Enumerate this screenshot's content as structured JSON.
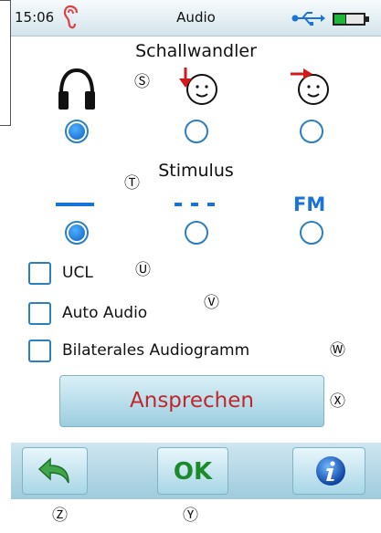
{
  "status": {
    "time": "15:06",
    "title": "Audio",
    "ear_icon": "ear-icon",
    "usb_icon": "usb-icon",
    "battery_icon": "battery-icon"
  },
  "transducer": {
    "title": "Schallwandler",
    "marker": "Ⓢ",
    "options": [
      {
        "icon": "headphones-icon",
        "selected": true
      },
      {
        "icon": "bone-conduction-face-icon",
        "selected": false
      },
      {
        "icon": "free-field-face-icon",
        "selected": false
      }
    ]
  },
  "stimulus": {
    "title": "Stimulus",
    "marker": "Ⓣ",
    "fm_label": "FM",
    "options": [
      {
        "icon": "solid-line-icon",
        "selected": true
      },
      {
        "icon": "dashed-line-icon",
        "selected": false
      },
      {
        "icon": "fm-icon",
        "selected": false
      }
    ]
  },
  "checkboxes": [
    {
      "label": "UCL",
      "marker": "Ⓤ",
      "checked": false
    },
    {
      "label": "Auto Audio",
      "marker": "Ⓥ",
      "checked": false
    },
    {
      "label": "Bilaterales Audiogramm",
      "marker": "Ⓦ",
      "checked": false
    }
  ],
  "respond": {
    "label": "Ansprechen",
    "marker": "Ⓧ"
  },
  "bottom": {
    "ok_label": "OK",
    "back_icon": "back-arrow-icon",
    "info_icon": "info-icon",
    "back_marker": "Ⓩ",
    "ok_marker": "Ⓨ"
  },
  "colors": {
    "accent": "#2b7fc1",
    "respond_text": "#c0272d",
    "ok_text": "#1a8a2a",
    "stimulus_blue": "#1a73d9"
  }
}
